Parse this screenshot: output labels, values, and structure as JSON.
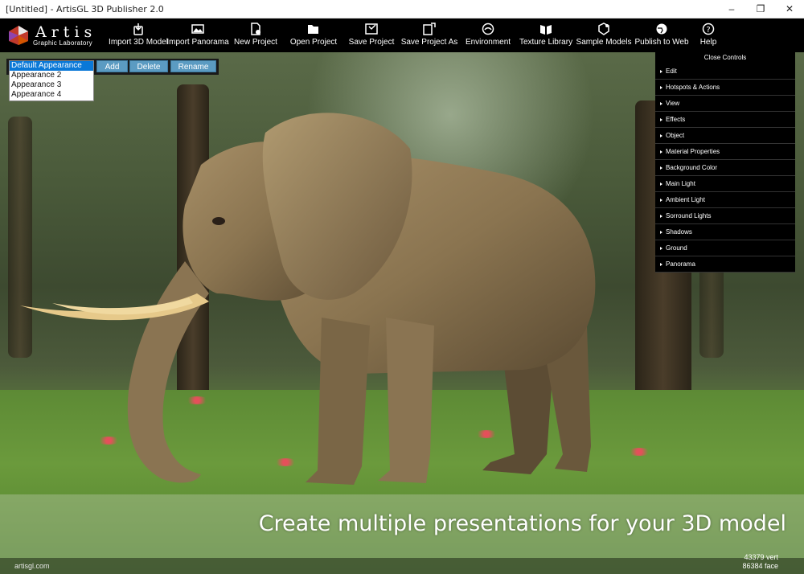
{
  "window": {
    "title": "[Untitled] - ArtisGL 3D Publisher 2.0",
    "controls": [
      "minimize",
      "maximize",
      "close"
    ]
  },
  "logo": {
    "name": "Artis",
    "subtitle": "Graphic Laboratory"
  },
  "toolbar": [
    {
      "label": "Import 3D Model",
      "icon": "import-model-icon"
    },
    {
      "label": "Import Panorama",
      "icon": "image-icon"
    },
    {
      "label": "New Project",
      "icon": "new-file-icon"
    },
    {
      "label": "Open Project",
      "icon": "folder-open-icon"
    },
    {
      "label": "Save Project",
      "icon": "save-icon"
    },
    {
      "label": "Save Project As",
      "icon": "save-as-icon"
    },
    {
      "label": "Environment",
      "icon": "environment-icon"
    },
    {
      "label": "Texture Library",
      "icon": "library-icon"
    },
    {
      "label": "Sample Models",
      "icon": "sample-models-icon"
    },
    {
      "label": "Publish to Web",
      "icon": "globe-icon"
    },
    {
      "label": "Help",
      "icon": "help-icon"
    }
  ],
  "appearances": {
    "items": [
      "Default Appearance",
      "Appearance 2",
      "Appearance 3",
      "Appearance 4"
    ],
    "selected": "Default Appearance",
    "buttons": {
      "add": "Add",
      "delete": "Delete",
      "rename": "Rename"
    }
  },
  "controls_panel": {
    "close_label": "Close Controls",
    "sections": [
      "Edit",
      "Hotspots & Actions",
      "View",
      "Effects",
      "Object",
      "Material Properties",
      "Background Color",
      "Main Light",
      "Ambient Light",
      "Sorround Lights",
      "Shadows",
      "Ground",
      "Panorama"
    ]
  },
  "caption": "Create multiple presentations for your 3D model",
  "footer": {
    "site": "artisgl.com",
    "vertices": "43379 vert",
    "faces": "86384 face"
  },
  "colors": {
    "button_blue": "#5b9bc2",
    "selection_blue": "#0a78d7",
    "toolbar_bg": "#000000"
  }
}
